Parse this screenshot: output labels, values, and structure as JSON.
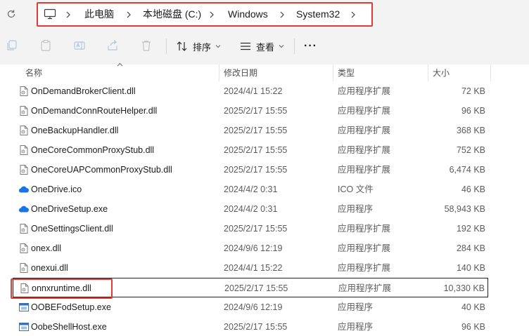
{
  "address": {
    "crumbs": [
      "此电脑",
      "本地磁盘 (C:)",
      "Windows",
      "System32"
    ]
  },
  "toolbar": {
    "sort_label": "排序",
    "view_label": "查看",
    "more_label": "···"
  },
  "columns": {
    "name": "名称",
    "date": "修改日期",
    "type": "类型",
    "size": "大小"
  },
  "files": [
    {
      "name": "OnDemandBrokerClient.dll",
      "date": "2024/4/1 15:22",
      "type": "应用程序扩展",
      "size": "72 KB",
      "icon": "dll-file-icon"
    },
    {
      "name": "OnDemandConnRouteHelper.dll",
      "date": "2025/2/17 15:55",
      "type": "应用程序扩展",
      "size": "96 KB",
      "icon": "dll-file-icon"
    },
    {
      "name": "OneBackupHandler.dll",
      "date": "2025/2/17 15:55",
      "type": "应用程序扩展",
      "size": "368 KB",
      "icon": "dll-file-icon"
    },
    {
      "name": "OneCoreCommonProxyStub.dll",
      "date": "2025/2/17 15:55",
      "type": "应用程序扩展",
      "size": "752 KB",
      "icon": "dll-file-icon"
    },
    {
      "name": "OneCoreUAPCommonProxyStub.dll",
      "date": "2025/2/17 15:55",
      "type": "应用程序扩展",
      "size": "6,474 KB",
      "icon": "dll-file-icon"
    },
    {
      "name": "OneDrive.ico",
      "date": "2024/4/2 0:31",
      "type": "ICO 文件",
      "size": "46 KB",
      "icon": "onedrive-cloud-icon"
    },
    {
      "name": "OneDriveSetup.exe",
      "date": "2024/4/2 0:31",
      "type": "应用程序",
      "size": "58,943 KB",
      "icon": "onedrive-cloud-icon"
    },
    {
      "name": "OneSettingsClient.dll",
      "date": "2025/2/17 15:55",
      "type": "应用程序扩展",
      "size": "192 KB",
      "icon": "dll-file-icon"
    },
    {
      "name": "onex.dll",
      "date": "2024/9/6 12:19",
      "type": "应用程序扩展",
      "size": "284 KB",
      "icon": "dll-file-icon"
    },
    {
      "name": "onexui.dll",
      "date": "2024/4/1 15:22",
      "type": "应用程序扩展",
      "size": "140 KB",
      "icon": "dll-file-icon"
    },
    {
      "name": "onnxruntime.dll",
      "date": "2025/2/17 15:55",
      "type": "应用程序扩展",
      "size": "10,330 KB",
      "icon": "dll-file-icon",
      "selected": true
    },
    {
      "name": "OOBEFodSetup.exe",
      "date": "2024/9/6 12:19",
      "type": "应用程序",
      "size": "40 KB",
      "icon": "exe-app-icon"
    },
    {
      "name": "OobeShellHost.exe",
      "date": "2025/2/17 15:55",
      "type": "应用程序",
      "size": "96 KB",
      "icon": "exe-app-icon"
    }
  ],
  "colors": {
    "highlight": "#e53935",
    "accent": "#1a73e8",
    "toolbar_bg": "#f3f3f3"
  }
}
